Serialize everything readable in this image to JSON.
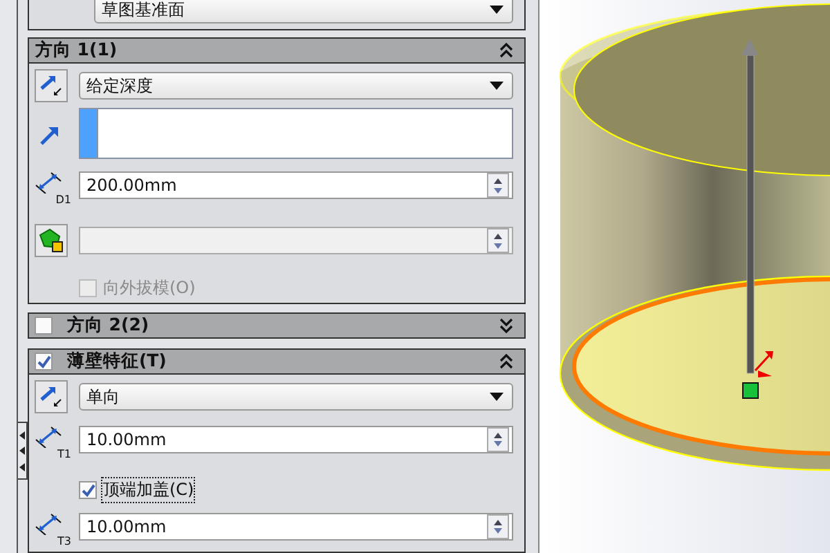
{
  "top_selector": {
    "value": "草图基准面"
  },
  "direction1": {
    "title": "方向 1(1)",
    "expanded": true,
    "end_condition": "给定深度",
    "depth_icon_label": "D1",
    "depth": "200.00mm",
    "draft_field": {
      "disabled": true
    },
    "draft_outward": {
      "label": "向外拔模(O)",
      "checked": false,
      "disabled": true
    }
  },
  "direction2": {
    "title": "方向 2(2)",
    "checked": false,
    "expanded": false
  },
  "thin_feature": {
    "title": "薄壁特征(T)",
    "checked": true,
    "expanded": true,
    "type": "单向",
    "thickness_icon_label": "T1",
    "thickness": "10.00mm",
    "cap_ends": {
      "label": "顶端加盖(C)",
      "checked": true
    },
    "cap_icon_label": "T3",
    "cap_thickness": "10.00mm"
  }
}
